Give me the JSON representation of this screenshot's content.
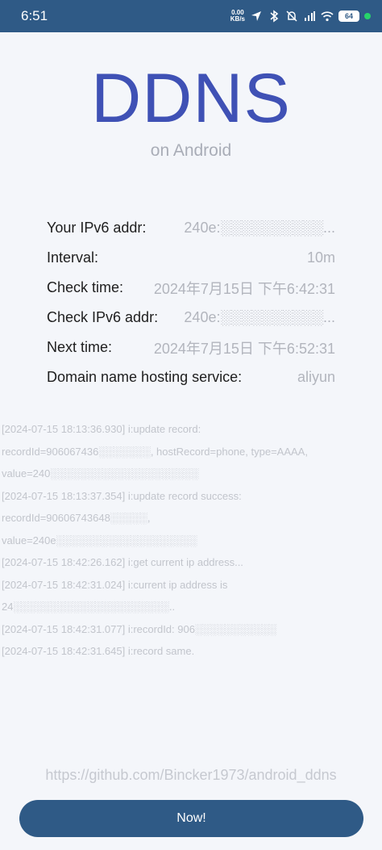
{
  "status_bar": {
    "time": "6:51",
    "net_speed_value": "0.00",
    "net_speed_unit": "KB/s",
    "battery": "64",
    "icons": [
      "navigation-icon",
      "bluetooth-icon",
      "mute-icon",
      "signal-hd-icon",
      "wifi-icon",
      "battery-icon",
      "status-dot"
    ]
  },
  "app": {
    "title": "DDNS",
    "subtitle": "on Android"
  },
  "info": {
    "ipv6_addr_label": "Your IPv6 addr:",
    "ipv6_addr_value": "240e:░░░░░░░░░░...",
    "interval_label": "Interval:",
    "interval_value": "10m",
    "check_time_label": "Check time:",
    "check_time_value": "2024年7月15日 下午6:42:31",
    "check_ipv6_label": "Check IPv6 addr:",
    "check_ipv6_value": "240e:░░░░░░░░░░...",
    "next_time_label": "Next time:",
    "next_time_value": "2024年7月15日 下午6:52:31",
    "hosting_label": "Domain name hosting service:",
    "hosting_value": "aliyun"
  },
  "log_lines": [
    "[2024-07-15 18:13:36.930] i:update record:",
    "recordId=906067436░░░░░░░, hostRecord=phone, type=AAAA,",
    "value=240░░░░░░░░░░░░░░░░░░░░",
    "[2024-07-15 18:13:37.354] i:update record success:",
    "recordId=90606743648░░░░░,",
    "value=240e░░░░░░░░░░░░░░░░░░░",
    "[2024-07-15 18:42:26.162] i:get current ip address...",
    "[2024-07-15 18:42:31.024] i:current ip address is",
    "24░░░░░░░░░░░░░░░░░░░░░..",
    "[2024-07-15 18:42:31.077] i:recordId: 906░░░░░░░░░░░",
    "[2024-07-15 18:42:31.645] i:record same."
  ],
  "footer": {
    "link": "https://github.com/Bincker1973/android_ddns",
    "button_label": "Now!"
  },
  "colors": {
    "accent": "#2f5a86",
    "title": "#3f51b5",
    "background": "#f4f6fa"
  }
}
